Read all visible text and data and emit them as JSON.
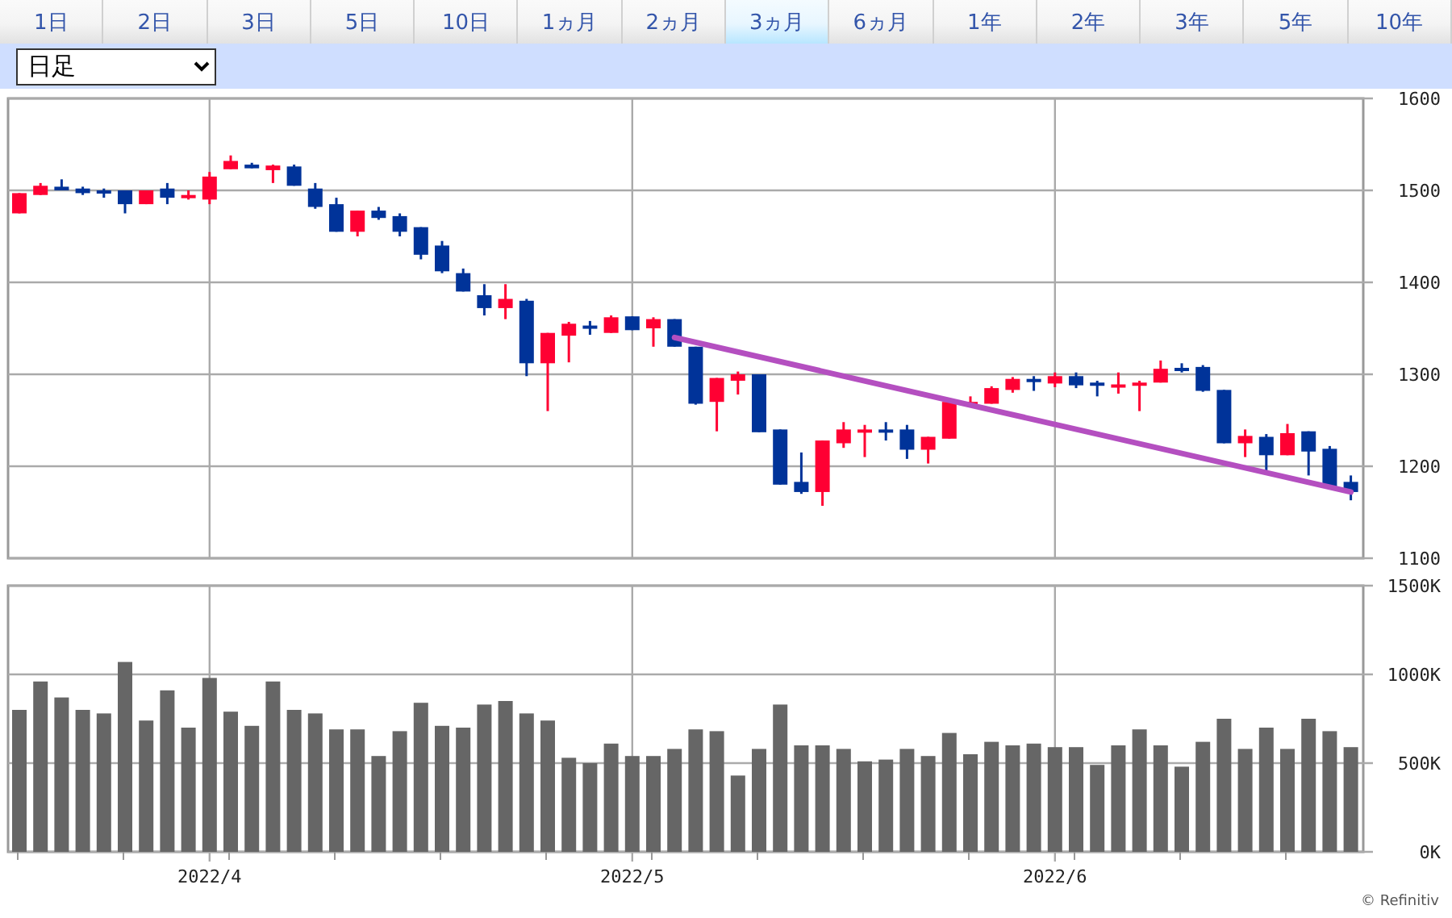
{
  "tabs": [
    {
      "label": "1日",
      "selected": false
    },
    {
      "label": "2日",
      "selected": false
    },
    {
      "label": "3日",
      "selected": false
    },
    {
      "label": "5日",
      "selected": false
    },
    {
      "label": "10日",
      "selected": false
    },
    {
      "label": "1ヵ月",
      "selected": false
    },
    {
      "label": "2ヵ月",
      "selected": false
    },
    {
      "label": "3ヵ月",
      "selected": true
    },
    {
      "label": "6ヵ月",
      "selected": false
    },
    {
      "label": "1年",
      "selected": false
    },
    {
      "label": "2年",
      "selected": false
    },
    {
      "label": "3年",
      "selected": false
    },
    {
      "label": "5年",
      "selected": false
    },
    {
      "label": "10年",
      "selected": false
    }
  ],
  "interval_select": {
    "value": "日足"
  },
  "price_chart": {
    "axis_labels": [
      "1600",
      "1500",
      "1400",
      "1300",
      "1200",
      "1100"
    ]
  },
  "volume_chart": {
    "chart_data": {
      "type": "bar",
      "grid": true,
      "ylim": [
        0,
        1500
      ],
      "yticks": [
        {
          "value": 0,
          "label": "0K"
        },
        {
          "value": 500,
          "label": "500K"
        },
        {
          "value": 1000,
          "label": "1000K"
        },
        {
          "value": 1500,
          "label": "1500K"
        }
      ],
      "values": [
        800,
        960,
        870,
        800,
        780,
        1070,
        740,
        910,
        700,
        980,
        790,
        710,
        960,
        800,
        780,
        690,
        690,
        540,
        680,
        840,
        710,
        700,
        830,
        850,
        780,
        740,
        530,
        500,
        610,
        540,
        540,
        580,
        690,
        680,
        430,
        580,
        830,
        600,
        600,
        580,
        510,
        520,
        580,
        540,
        670,
        550,
        620,
        600,
        610,
        590,
        590,
        490,
        600,
        690,
        600,
        480,
        620,
        750,
        580,
        700,
        580,
        750,
        680,
        590
      ]
    },
    "date_labels": [
      "2022/4",
      "2022/5",
      "2022/6"
    ]
  },
  "credit": "© Refinitiv"
}
